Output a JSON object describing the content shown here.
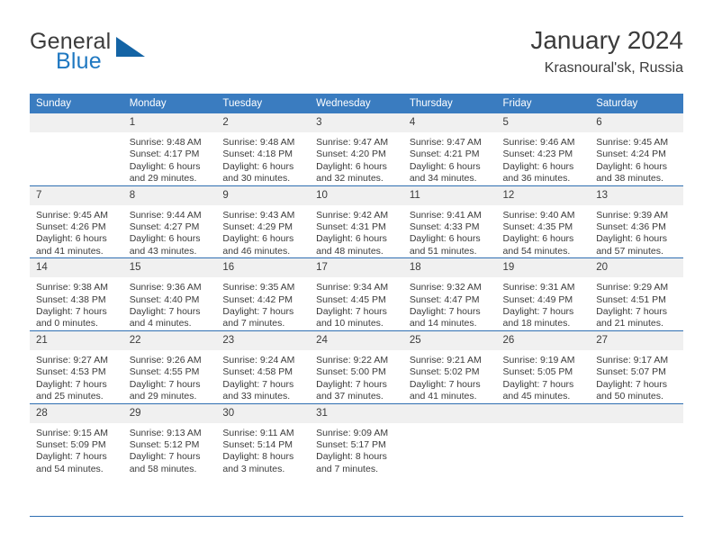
{
  "brand": {
    "name_part1": "General",
    "name_part2": "Blue",
    "logo_icon": "triangle-logo-icon",
    "accent_color": "#1464a5"
  },
  "header": {
    "title": "January 2024",
    "subtitle": "Krasnoural'sk, Russia"
  },
  "theme": {
    "header_bg": "#3a7cc0",
    "header_text": "#ffffff",
    "rule_color": "#2f6fb2",
    "daynum_bg": "#f0f0f0",
    "body_text": "#3b3b3b"
  },
  "weekday_headers": [
    "Sunday",
    "Monday",
    "Tuesday",
    "Wednesday",
    "Thursday",
    "Friday",
    "Saturday"
  ],
  "labels": {
    "sunrise": "Sunrise:",
    "sunset": "Sunset:",
    "daylight": "Daylight:"
  },
  "weeks": [
    [
      {
        "day": "",
        "sunrise": "",
        "sunset": "",
        "daylight_line1": "",
        "daylight_line2": "",
        "empty": true
      },
      {
        "day": "1",
        "sunrise": "Sunrise: 9:48 AM",
        "sunset": "Sunset: 4:17 PM",
        "daylight_line1": "Daylight: 6 hours",
        "daylight_line2": "and 29 minutes."
      },
      {
        "day": "2",
        "sunrise": "Sunrise: 9:48 AM",
        "sunset": "Sunset: 4:18 PM",
        "daylight_line1": "Daylight: 6 hours",
        "daylight_line2": "and 30 minutes."
      },
      {
        "day": "3",
        "sunrise": "Sunrise: 9:47 AM",
        "sunset": "Sunset: 4:20 PM",
        "daylight_line1": "Daylight: 6 hours",
        "daylight_line2": "and 32 minutes."
      },
      {
        "day": "4",
        "sunrise": "Sunrise: 9:47 AM",
        "sunset": "Sunset: 4:21 PM",
        "daylight_line1": "Daylight: 6 hours",
        "daylight_line2": "and 34 minutes."
      },
      {
        "day": "5",
        "sunrise": "Sunrise: 9:46 AM",
        "sunset": "Sunset: 4:23 PM",
        "daylight_line1": "Daylight: 6 hours",
        "daylight_line2": "and 36 minutes."
      },
      {
        "day": "6",
        "sunrise": "Sunrise: 9:45 AM",
        "sunset": "Sunset: 4:24 PM",
        "daylight_line1": "Daylight: 6 hours",
        "daylight_line2": "and 38 minutes."
      }
    ],
    [
      {
        "day": "7",
        "sunrise": "Sunrise: 9:45 AM",
        "sunset": "Sunset: 4:26 PM",
        "daylight_line1": "Daylight: 6 hours",
        "daylight_line2": "and 41 minutes."
      },
      {
        "day": "8",
        "sunrise": "Sunrise: 9:44 AM",
        "sunset": "Sunset: 4:27 PM",
        "daylight_line1": "Daylight: 6 hours",
        "daylight_line2": "and 43 minutes."
      },
      {
        "day": "9",
        "sunrise": "Sunrise: 9:43 AM",
        "sunset": "Sunset: 4:29 PM",
        "daylight_line1": "Daylight: 6 hours",
        "daylight_line2": "and 46 minutes."
      },
      {
        "day": "10",
        "sunrise": "Sunrise: 9:42 AM",
        "sunset": "Sunset: 4:31 PM",
        "daylight_line1": "Daylight: 6 hours",
        "daylight_line2": "and 48 minutes."
      },
      {
        "day": "11",
        "sunrise": "Sunrise: 9:41 AM",
        "sunset": "Sunset: 4:33 PM",
        "daylight_line1": "Daylight: 6 hours",
        "daylight_line2": "and 51 minutes."
      },
      {
        "day": "12",
        "sunrise": "Sunrise: 9:40 AM",
        "sunset": "Sunset: 4:35 PM",
        "daylight_line1": "Daylight: 6 hours",
        "daylight_line2": "and 54 minutes."
      },
      {
        "day": "13",
        "sunrise": "Sunrise: 9:39 AM",
        "sunset": "Sunset: 4:36 PM",
        "daylight_line1": "Daylight: 6 hours",
        "daylight_line2": "and 57 minutes."
      }
    ],
    [
      {
        "day": "14",
        "sunrise": "Sunrise: 9:38 AM",
        "sunset": "Sunset: 4:38 PM",
        "daylight_line1": "Daylight: 7 hours",
        "daylight_line2": "and 0 minutes."
      },
      {
        "day": "15",
        "sunrise": "Sunrise: 9:36 AM",
        "sunset": "Sunset: 4:40 PM",
        "daylight_line1": "Daylight: 7 hours",
        "daylight_line2": "and 4 minutes."
      },
      {
        "day": "16",
        "sunrise": "Sunrise: 9:35 AM",
        "sunset": "Sunset: 4:42 PM",
        "daylight_line1": "Daylight: 7 hours",
        "daylight_line2": "and 7 minutes."
      },
      {
        "day": "17",
        "sunrise": "Sunrise: 9:34 AM",
        "sunset": "Sunset: 4:45 PM",
        "daylight_line1": "Daylight: 7 hours",
        "daylight_line2": "and 10 minutes."
      },
      {
        "day": "18",
        "sunrise": "Sunrise: 9:32 AM",
        "sunset": "Sunset: 4:47 PM",
        "daylight_line1": "Daylight: 7 hours",
        "daylight_line2": "and 14 minutes."
      },
      {
        "day": "19",
        "sunrise": "Sunrise: 9:31 AM",
        "sunset": "Sunset: 4:49 PM",
        "daylight_line1": "Daylight: 7 hours",
        "daylight_line2": "and 18 minutes."
      },
      {
        "day": "20",
        "sunrise": "Sunrise: 9:29 AM",
        "sunset": "Sunset: 4:51 PM",
        "daylight_line1": "Daylight: 7 hours",
        "daylight_line2": "and 21 minutes."
      }
    ],
    [
      {
        "day": "21",
        "sunrise": "Sunrise: 9:27 AM",
        "sunset": "Sunset: 4:53 PM",
        "daylight_line1": "Daylight: 7 hours",
        "daylight_line2": "and 25 minutes."
      },
      {
        "day": "22",
        "sunrise": "Sunrise: 9:26 AM",
        "sunset": "Sunset: 4:55 PM",
        "daylight_line1": "Daylight: 7 hours",
        "daylight_line2": "and 29 minutes."
      },
      {
        "day": "23",
        "sunrise": "Sunrise: 9:24 AM",
        "sunset": "Sunset: 4:58 PM",
        "daylight_line1": "Daylight: 7 hours",
        "daylight_line2": "and 33 minutes."
      },
      {
        "day": "24",
        "sunrise": "Sunrise: 9:22 AM",
        "sunset": "Sunset: 5:00 PM",
        "daylight_line1": "Daylight: 7 hours",
        "daylight_line2": "and 37 minutes."
      },
      {
        "day": "25",
        "sunrise": "Sunrise: 9:21 AM",
        "sunset": "Sunset: 5:02 PM",
        "daylight_line1": "Daylight: 7 hours",
        "daylight_line2": "and 41 minutes."
      },
      {
        "day": "26",
        "sunrise": "Sunrise: 9:19 AM",
        "sunset": "Sunset: 5:05 PM",
        "daylight_line1": "Daylight: 7 hours",
        "daylight_line2": "and 45 minutes."
      },
      {
        "day": "27",
        "sunrise": "Sunrise: 9:17 AM",
        "sunset": "Sunset: 5:07 PM",
        "daylight_line1": "Daylight: 7 hours",
        "daylight_line2": "and 50 minutes."
      }
    ],
    [
      {
        "day": "28",
        "sunrise": "Sunrise: 9:15 AM",
        "sunset": "Sunset: 5:09 PM",
        "daylight_line1": "Daylight: 7 hours",
        "daylight_line2": "and 54 minutes."
      },
      {
        "day": "29",
        "sunrise": "Sunrise: 9:13 AM",
        "sunset": "Sunset: 5:12 PM",
        "daylight_line1": "Daylight: 7 hours",
        "daylight_line2": "and 58 minutes."
      },
      {
        "day": "30",
        "sunrise": "Sunrise: 9:11 AM",
        "sunset": "Sunset: 5:14 PM",
        "daylight_line1": "Daylight: 8 hours",
        "daylight_line2": "and 3 minutes."
      },
      {
        "day": "31",
        "sunrise": "Sunrise: 9:09 AM",
        "sunset": "Sunset: 5:17 PM",
        "daylight_line1": "Daylight: 8 hours",
        "daylight_line2": "and 7 minutes."
      },
      {
        "day": "",
        "sunrise": "",
        "sunset": "",
        "daylight_line1": "",
        "daylight_line2": "",
        "empty": true
      },
      {
        "day": "",
        "sunrise": "",
        "sunset": "",
        "daylight_line1": "",
        "daylight_line2": "",
        "empty": true
      },
      {
        "day": "",
        "sunrise": "",
        "sunset": "",
        "daylight_line1": "",
        "daylight_line2": "",
        "empty": true
      }
    ]
  ]
}
